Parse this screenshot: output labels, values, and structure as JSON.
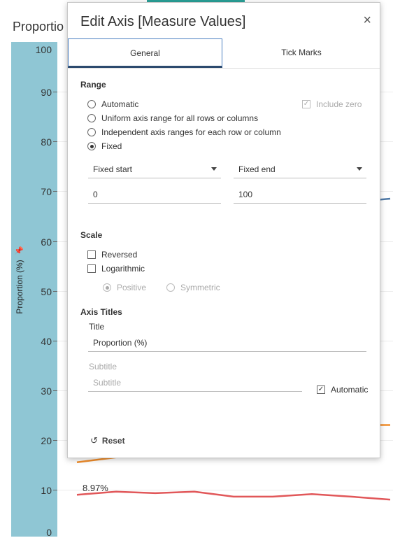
{
  "background": {
    "sheet_title": "Proportio",
    "axis_title": "Proportion (%)",
    "axis_ticks": [
      "100",
      "90",
      "80",
      "70",
      "60",
      "50",
      "40",
      "30",
      "20",
      "10",
      "0"
    ],
    "data_label": "8.97%",
    "colors": {
      "axis_band": "#8fc6d4",
      "blue_line": "#4e79a7",
      "orange_line": "#f28e2b",
      "red_line": "#e15759"
    }
  },
  "chart_data": {
    "type": "line",
    "ylim": [
      0,
      100
    ],
    "ylabel": "Proportion (%)",
    "series": [
      {
        "color": "#e15759",
        "x": [
          0,
          1,
          2,
          3,
          4,
          5,
          6,
          7,
          8
        ],
        "values": [
          8.97,
          9.6,
          9.3,
          9.6,
          8.6,
          8.6,
          9.1,
          8.6,
          8.0
        ]
      },
      {
        "color": "#f28e2b",
        "x": [
          0,
          1
        ],
        "values": [
          15.5,
          16.5
        ]
      },
      {
        "color": "#f28e2b",
        "x": [
          7.6,
          8
        ],
        "values": [
          23.0,
          23.0
        ]
      },
      {
        "color": "#4e79a7",
        "x": [
          7.3,
          8
        ],
        "values": [
          68.0,
          68.5
        ]
      }
    ]
  },
  "dialog": {
    "title": "Edit Axis [Measure Values]",
    "close_label": "×",
    "tabs": {
      "general": "General",
      "tick_marks": "Tick Marks"
    },
    "range": {
      "heading": "Range",
      "options": {
        "automatic": "Automatic",
        "uniform": "Uniform axis range for all rows or columns",
        "independent": "Independent axis ranges for each row or column",
        "fixed": "Fixed"
      },
      "selected": "fixed",
      "include_zero": "Include zero",
      "fixed_start_label": "Fixed start",
      "fixed_end_label": "Fixed end",
      "start_value": "0",
      "end_value": "100"
    },
    "scale": {
      "heading": "Scale",
      "reversed": "Reversed",
      "logarithmic": "Logarithmic",
      "positive": "Positive",
      "symmetric": "Symmetric"
    },
    "axis_titles": {
      "heading": "Axis Titles",
      "title_label": "Title",
      "title_value": "Proportion (%)",
      "subtitle_label": "Subtitle",
      "subtitle_placeholder": "Subtitle",
      "automatic": "Automatic"
    },
    "reset_label": "Reset"
  }
}
